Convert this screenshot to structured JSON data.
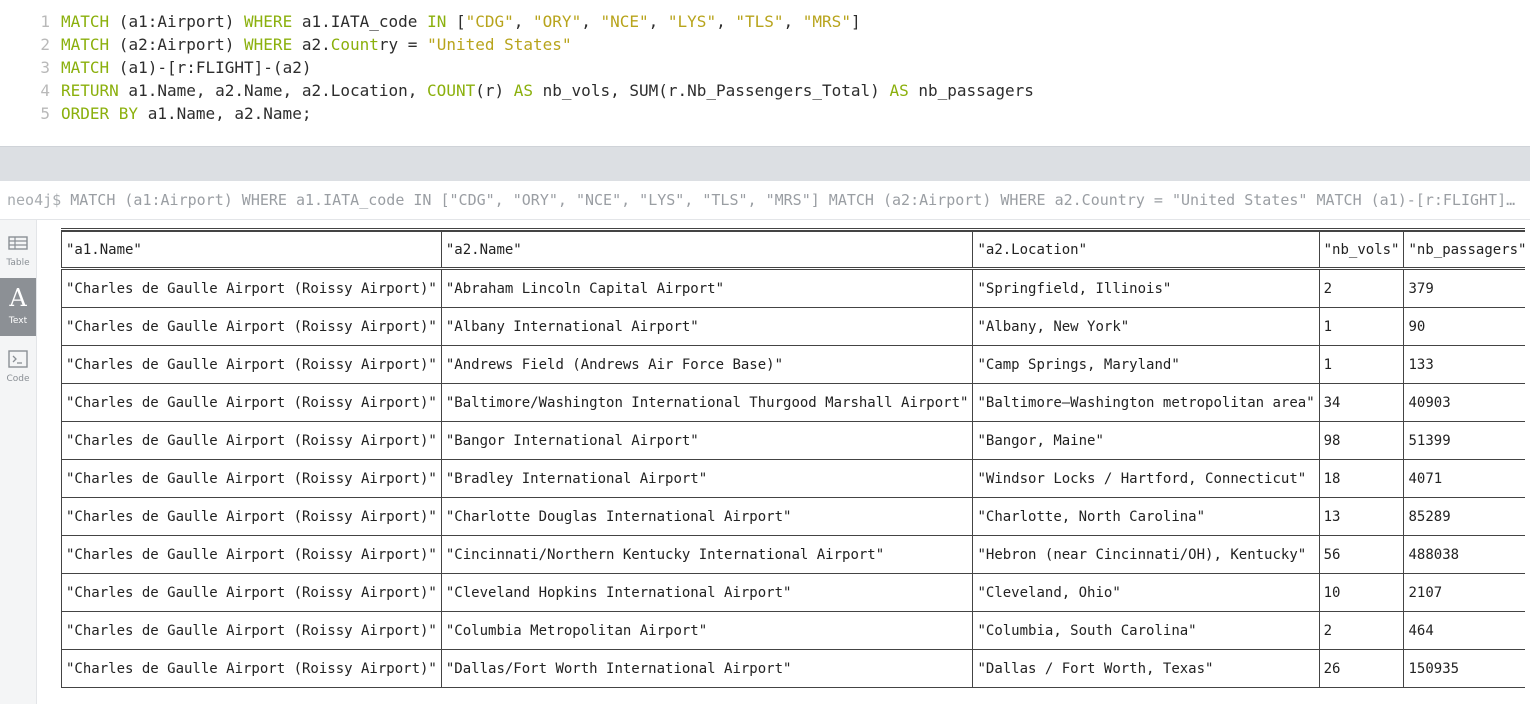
{
  "editor": {
    "lines": [
      {
        "num": "1",
        "tokens": [
          [
            "kw",
            "MATCH"
          ],
          [
            "plain",
            " (a1:Airport) "
          ],
          [
            "kw",
            "WHERE"
          ],
          [
            "plain",
            " a1.IATA_code "
          ],
          [
            "kw",
            "IN"
          ],
          [
            "plain",
            " ["
          ],
          [
            "str",
            "\"CDG\""
          ],
          [
            "plain",
            ", "
          ],
          [
            "str",
            "\"ORY\""
          ],
          [
            "plain",
            ", "
          ],
          [
            "str",
            "\"NCE\""
          ],
          [
            "plain",
            ", "
          ],
          [
            "str",
            "\"LYS\""
          ],
          [
            "plain",
            ", "
          ],
          [
            "str",
            "\"TLS\""
          ],
          [
            "plain",
            ", "
          ],
          [
            "str",
            "\"MRS\""
          ],
          [
            "plain",
            "]"
          ]
        ]
      },
      {
        "num": "2",
        "tokens": [
          [
            "kw",
            "MATCH"
          ],
          [
            "plain",
            " (a2:Airport) "
          ],
          [
            "kw",
            "WHERE"
          ],
          [
            "plain",
            " a2."
          ],
          [
            "kw",
            "Count"
          ],
          [
            "plain",
            "ry = "
          ],
          [
            "str",
            "\"United States\""
          ]
        ]
      },
      {
        "num": "3",
        "tokens": [
          [
            "kw",
            "MATCH"
          ],
          [
            "plain",
            " (a1)-[r:FLIGHT]-(a2)"
          ]
        ]
      },
      {
        "num": "4",
        "tokens": [
          [
            "kw",
            "RETURN"
          ],
          [
            "plain",
            " a1.Name, a2.Name, a2.Location, "
          ],
          [
            "kw",
            "COUNT"
          ],
          [
            "plain",
            "(r) "
          ],
          [
            "kw",
            "AS"
          ],
          [
            "plain",
            " nb_vols, SUM(r.Nb_Passengers_Total) "
          ],
          [
            "kw",
            "AS"
          ],
          [
            "plain",
            " nb_passagers"
          ]
        ]
      },
      {
        "num": "5",
        "tokens": [
          [
            "kw",
            "ORDER BY"
          ],
          [
            "plain",
            " a1.Name, a2.Name;"
          ]
        ]
      }
    ]
  },
  "result": {
    "prompt": "neo4j$",
    "command": "MATCH (a1:Airport) WHERE a1.IATA_code IN [\"CDG\", \"ORY\", \"NCE\", \"LYS\", \"TLS\", \"MRS\"] MATCH (a2:Airport) WHERE a2.Country = \"United States\" MATCH (a1)-[r:FLIGHT]-(a2) RETURN a1.Name, a2.Name, a2.Location, COUNT(r) AS nb_vols, SUM(r.Nb_Passengers_Total) AS nb_passagers ORDER BY a1.Name, a2.Name;"
  },
  "sidebar": {
    "items": [
      {
        "label": "Table",
        "icon": "table-icon",
        "active": false
      },
      {
        "label": "Text",
        "icon": "text-icon",
        "active": true
      },
      {
        "label": "Code",
        "icon": "code-icon",
        "active": false
      }
    ]
  },
  "table": {
    "headers": [
      "\"a1.Name\"",
      "\"a2.Name\"",
      "\"a2.Location\"",
      "\"nb_vols\"",
      "\"nb_passagers\""
    ],
    "rows": [
      [
        "\"Charles de Gaulle Airport (Roissy Airport)\"",
        "\"Abraham Lincoln Capital Airport\"",
        "\"Springfield, Illinois\"",
        "2",
        "379"
      ],
      [
        "\"Charles de Gaulle Airport (Roissy Airport)\"",
        "\"Albany International Airport\"",
        "\"Albany, New York\"",
        "1",
        "90"
      ],
      [
        "\"Charles de Gaulle Airport (Roissy Airport)\"",
        "\"Andrews Field (Andrews Air Force Base)\"",
        "\"Camp Springs, Maryland\"",
        "1",
        "133"
      ],
      [
        "\"Charles de Gaulle Airport (Roissy Airport)\"",
        "\"Baltimore/Washington International Thurgood Marshall Airport\"",
        "\"Baltimore–Washington metropolitan area\"",
        "34",
        "40903"
      ],
      [
        "\"Charles de Gaulle Airport (Roissy Airport)\"",
        "\"Bangor International Airport\"",
        "\"Bangor, Maine\"",
        "98",
        "51399"
      ],
      [
        "\"Charles de Gaulle Airport (Roissy Airport)\"",
        "\"Bradley International Airport\"",
        "\"Windsor Locks / Hartford, Connecticut\"",
        "18",
        "4071"
      ],
      [
        "\"Charles de Gaulle Airport (Roissy Airport)\"",
        "\"Charlotte Douglas International Airport\"",
        "\"Charlotte, North Carolina\"",
        "13",
        "85289"
      ],
      [
        "\"Charles de Gaulle Airport (Roissy Airport)\"",
        "\"Cincinnati/Northern Kentucky International Airport\"",
        "\"Hebron (near Cincinnati/OH), Kentucky\"",
        "56",
        "488038"
      ],
      [
        "\"Charles de Gaulle Airport (Roissy Airport)\"",
        "\"Cleveland Hopkins International Airport\"",
        "\"Cleveland, Ohio\"",
        "10",
        "2107"
      ],
      [
        "\"Charles de Gaulle Airport (Roissy Airport)\"",
        "\"Columbia Metropolitan Airport\"",
        "\"Columbia, South Carolina\"",
        "2",
        "464"
      ],
      [
        "\"Charles de Gaulle Airport (Roissy Airport)\"",
        "\"Dallas/Fort Worth International Airport\"",
        "\"Dallas / Fort Worth, Texas\"",
        "26",
        "150935"
      ]
    ]
  }
}
